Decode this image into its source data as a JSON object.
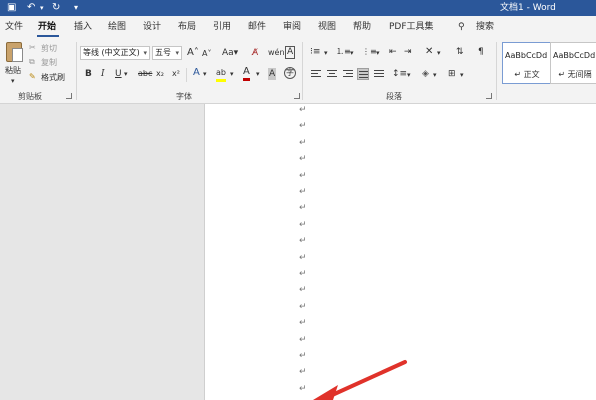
{
  "titlebar": {
    "save_icon": "floppy-disk-icon",
    "undo_icon": "undo-icon",
    "redo_icon": "redo-icon",
    "customize_icon": "customize-quick-access-icon",
    "title": "文档1 - Word"
  },
  "tabs": [
    {
      "label": "文件"
    },
    {
      "label": "开始",
      "active": true
    },
    {
      "label": "插入"
    },
    {
      "label": "绘图"
    },
    {
      "label": "设计"
    },
    {
      "label": "布局"
    },
    {
      "label": "引用"
    },
    {
      "label": "邮件"
    },
    {
      "label": "审阅"
    },
    {
      "label": "视图"
    },
    {
      "label": "帮助"
    },
    {
      "label": "PDF工具集"
    }
  ],
  "search": {
    "icon": "lightbulb-icon",
    "label": "搜索"
  },
  "clipboard": {
    "paste_label": "粘贴",
    "cut_label": "剪切",
    "copy_label": "复制",
    "format_painter_label": "格式刷",
    "group_label": "剪贴板"
  },
  "font": {
    "font_name": "等线 (中文正文)",
    "font_size": "五号",
    "grow_label": "A",
    "shrink_label": "A",
    "case_label": "Aa",
    "bold": "B",
    "italic": "I",
    "underline": "U",
    "strike": "abc",
    "subscript": "x₂",
    "superscript": "x²",
    "text_effect": "A",
    "highlight": "ab",
    "font_color": "A",
    "phonetic": "wén",
    "border_char": "A",
    "enclose_char": "字",
    "group_label": "字体"
  },
  "paragraph": {
    "group_label": "段落"
  },
  "styles": [
    {
      "sample": "AaBbCcDd",
      "name": "↵ 正文"
    },
    {
      "sample": "AaBbCcDd",
      "name": "↵ 无间隔"
    }
  ],
  "document": {
    "paragraph_mark": "↵",
    "mark_count": 18
  },
  "colors": {
    "accent": "#2b579a",
    "font_color_red": "#c00000",
    "arrow": "#e0322a"
  }
}
